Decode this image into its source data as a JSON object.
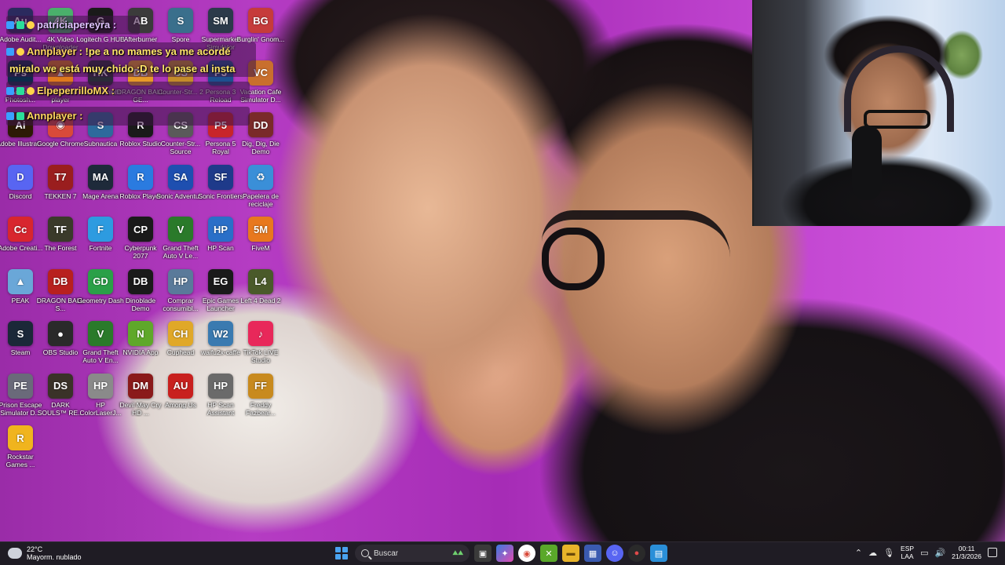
{
  "desktop": {
    "icons": [
      {
        "label": "Adobe Audit...",
        "glyph": "Au",
        "color": "#2b2a5e"
      },
      {
        "label": "4K Video Downloader",
        "glyph": "4K",
        "color": "#4ab06b"
      },
      {
        "label": "Logitech G HUB",
        "glyph": "G",
        "color": "#1a1a1a"
      },
      {
        "label": "Afterburner",
        "glyph": "AB",
        "color": "#3b3b3b"
      },
      {
        "label": "Spore",
        "glyph": "S",
        "color": "#3a6f8c"
      },
      {
        "label": "Supermarket Simulator",
        "glyph": "SM",
        "color": "#2b3a4a"
      },
      {
        "label": "Burglin' Gnom...",
        "glyph": "BG",
        "color": "#c63b3b"
      },
      {
        "label": "Adobe Photosh...",
        "glyph": "Ps",
        "color": "#0e2a4a"
      },
      {
        "label": "VLC media player",
        "glyph": "▲",
        "color": "#e0791d"
      },
      {
        "label": "Hollow Knight",
        "glyph": "HK",
        "color": "#2a2a38"
      },
      {
        "label": "DRAGON BALL GE...",
        "glyph": "DB",
        "color": "#e89a28"
      },
      {
        "label": "Counter-Str... 2",
        "glyph": "CS",
        "color": "#c48c2a"
      },
      {
        "label": "Persona 3 Reload",
        "glyph": "P3",
        "color": "#1d4f8f"
      },
      {
        "label": "Vacation Cafe Simulator D...",
        "glyph": "VC",
        "color": "#c96f2d"
      },
      {
        "label": "Adobe Illustrat...",
        "glyph": "Ai",
        "color": "#2d1a05"
      },
      {
        "label": "Google Chrome",
        "glyph": "◉",
        "color": "#d94a3a"
      },
      {
        "label": "Subnautica",
        "glyph": "S",
        "color": "#2d6a9c"
      },
      {
        "label": "Roblox Studio",
        "glyph": "R",
        "color": "#1a1a1a"
      },
      {
        "label": "Counter-Str... Source",
        "glyph": "CS",
        "color": "#5a5a5a"
      },
      {
        "label": "Persona 5 Royal",
        "glyph": "P5",
        "color": "#c8252a"
      },
      {
        "label": "Dig, Dig, Die Demo",
        "glyph": "DD",
        "color": "#7a2a2a"
      },
      {
        "label": "Discord",
        "glyph": "D",
        "color": "#5865f2"
      },
      {
        "label": "TEKKEN 7",
        "glyph": "T7",
        "color": "#9a1e1e"
      },
      {
        "label": "Mage Arena",
        "glyph": "MA",
        "color": "#1e2a3a"
      },
      {
        "label": "Roblox Player",
        "glyph": "R",
        "color": "#2a7be0"
      },
      {
        "label": "Sonic Adventu...",
        "glyph": "SA",
        "color": "#1e4fb0"
      },
      {
        "label": "Sonic Frontiers",
        "glyph": "SF",
        "color": "#1e3a8a"
      },
      {
        "label": "Papelera de reciclaje",
        "glyph": "♻",
        "color": "#3a8fd8"
      },
      {
        "label": "Adobe Creati...",
        "glyph": "Cc",
        "color": "#d8262e"
      },
      {
        "label": "The Forest",
        "glyph": "TF",
        "color": "#3a3a2a"
      },
      {
        "label": "Fortnite",
        "glyph": "F",
        "color": "#2d9be0"
      },
      {
        "label": "Cyberpunk 2077",
        "glyph": "CP",
        "color": "#1a1a1a"
      },
      {
        "label": "Grand Theft Auto V Le...",
        "glyph": "V",
        "color": "#2a7a2a"
      },
      {
        "label": "HP Scan",
        "glyph": "HP",
        "color": "#2a6fc8"
      },
      {
        "label": "FiveM",
        "glyph": "5M",
        "color": "#e8781e"
      },
      {
        "label": "PEAK",
        "glyph": "▲",
        "color": "#6aa7d8"
      },
      {
        "label": "DRAGON BALL S...",
        "glyph": "DB",
        "color": "#b8201e"
      },
      {
        "label": "Geometry Dash",
        "glyph": "GD",
        "color": "#2aa048"
      },
      {
        "label": "Dinoblade Demo",
        "glyph": "DB",
        "color": "#1a1a1a"
      },
      {
        "label": "Comprar consumibl...",
        "glyph": "HP",
        "color": "#5a7a9a"
      },
      {
        "label": "Epic Games Launcher",
        "glyph": "EG",
        "color": "#1a1a1a"
      },
      {
        "label": "Left 4 Dead 2",
        "glyph": "L4",
        "color": "#4a5a2a"
      },
      {
        "label": "Steam",
        "glyph": "S",
        "color": "#1b2838"
      },
      {
        "label": "OBS Studio",
        "glyph": "●",
        "color": "#2a2a2a"
      },
      {
        "label": "Grand Theft Auto V En...",
        "glyph": "V",
        "color": "#2a7a2a"
      },
      {
        "label": "NVIDIA App",
        "glyph": "N",
        "color": "#5fa82a"
      },
      {
        "label": "Cuphead",
        "glyph": "CH",
        "color": "#e0a828"
      },
      {
        "label": "waifu2x-caffe",
        "glyph": "W2",
        "color": "#3a7ab0"
      },
      {
        "label": "TikTok LIVE Studio",
        "glyph": "♪",
        "color": "#e8285a"
      },
      {
        "label": "Prison Escape Simulator D...",
        "glyph": "PE",
        "color": "#6a6a7a"
      },
      {
        "label": "DARK SOULS™ RE...",
        "glyph": "DS",
        "color": "#3a3228"
      },
      {
        "label": "HP ColorLaserJ...",
        "glyph": "HP",
        "color": "#8a8a8a"
      },
      {
        "label": "Devil May Cry HD ...",
        "glyph": "DM",
        "color": "#8a1a1a"
      },
      {
        "label": "Among Us",
        "glyph": "AU",
        "color": "#c8201e"
      },
      {
        "label": "HP Scan Assistant",
        "glyph": "HP",
        "color": "#6a6a6a"
      },
      {
        "label": "Freddy Fazbear...",
        "glyph": "FF",
        "color": "#c88a1e"
      },
      {
        "label": "Rockstar Games ...",
        "glyph": "R",
        "color": "#f0b41e"
      }
    ]
  },
  "chat": {
    "line1_user": "patriciapereyra :",
    "line2_user": "Annplayer",
    "line2_msg_a": ": !pe a no mames ya me acordé",
    "line2_msg_b": "miralo we está muy chido :D te lo pase al insta",
    "line3_user": "ElpeperrilloMX :",
    "line4_user": "Annplayer :"
  },
  "taskbar": {
    "weather_temp": "22°C",
    "weather_desc": "Mayorm. nublado",
    "search_placeholder": "Buscar",
    "lang_line1": "ESP",
    "lang_line2": "LAA",
    "time": "00:11",
    "date": "21/3/2026"
  }
}
